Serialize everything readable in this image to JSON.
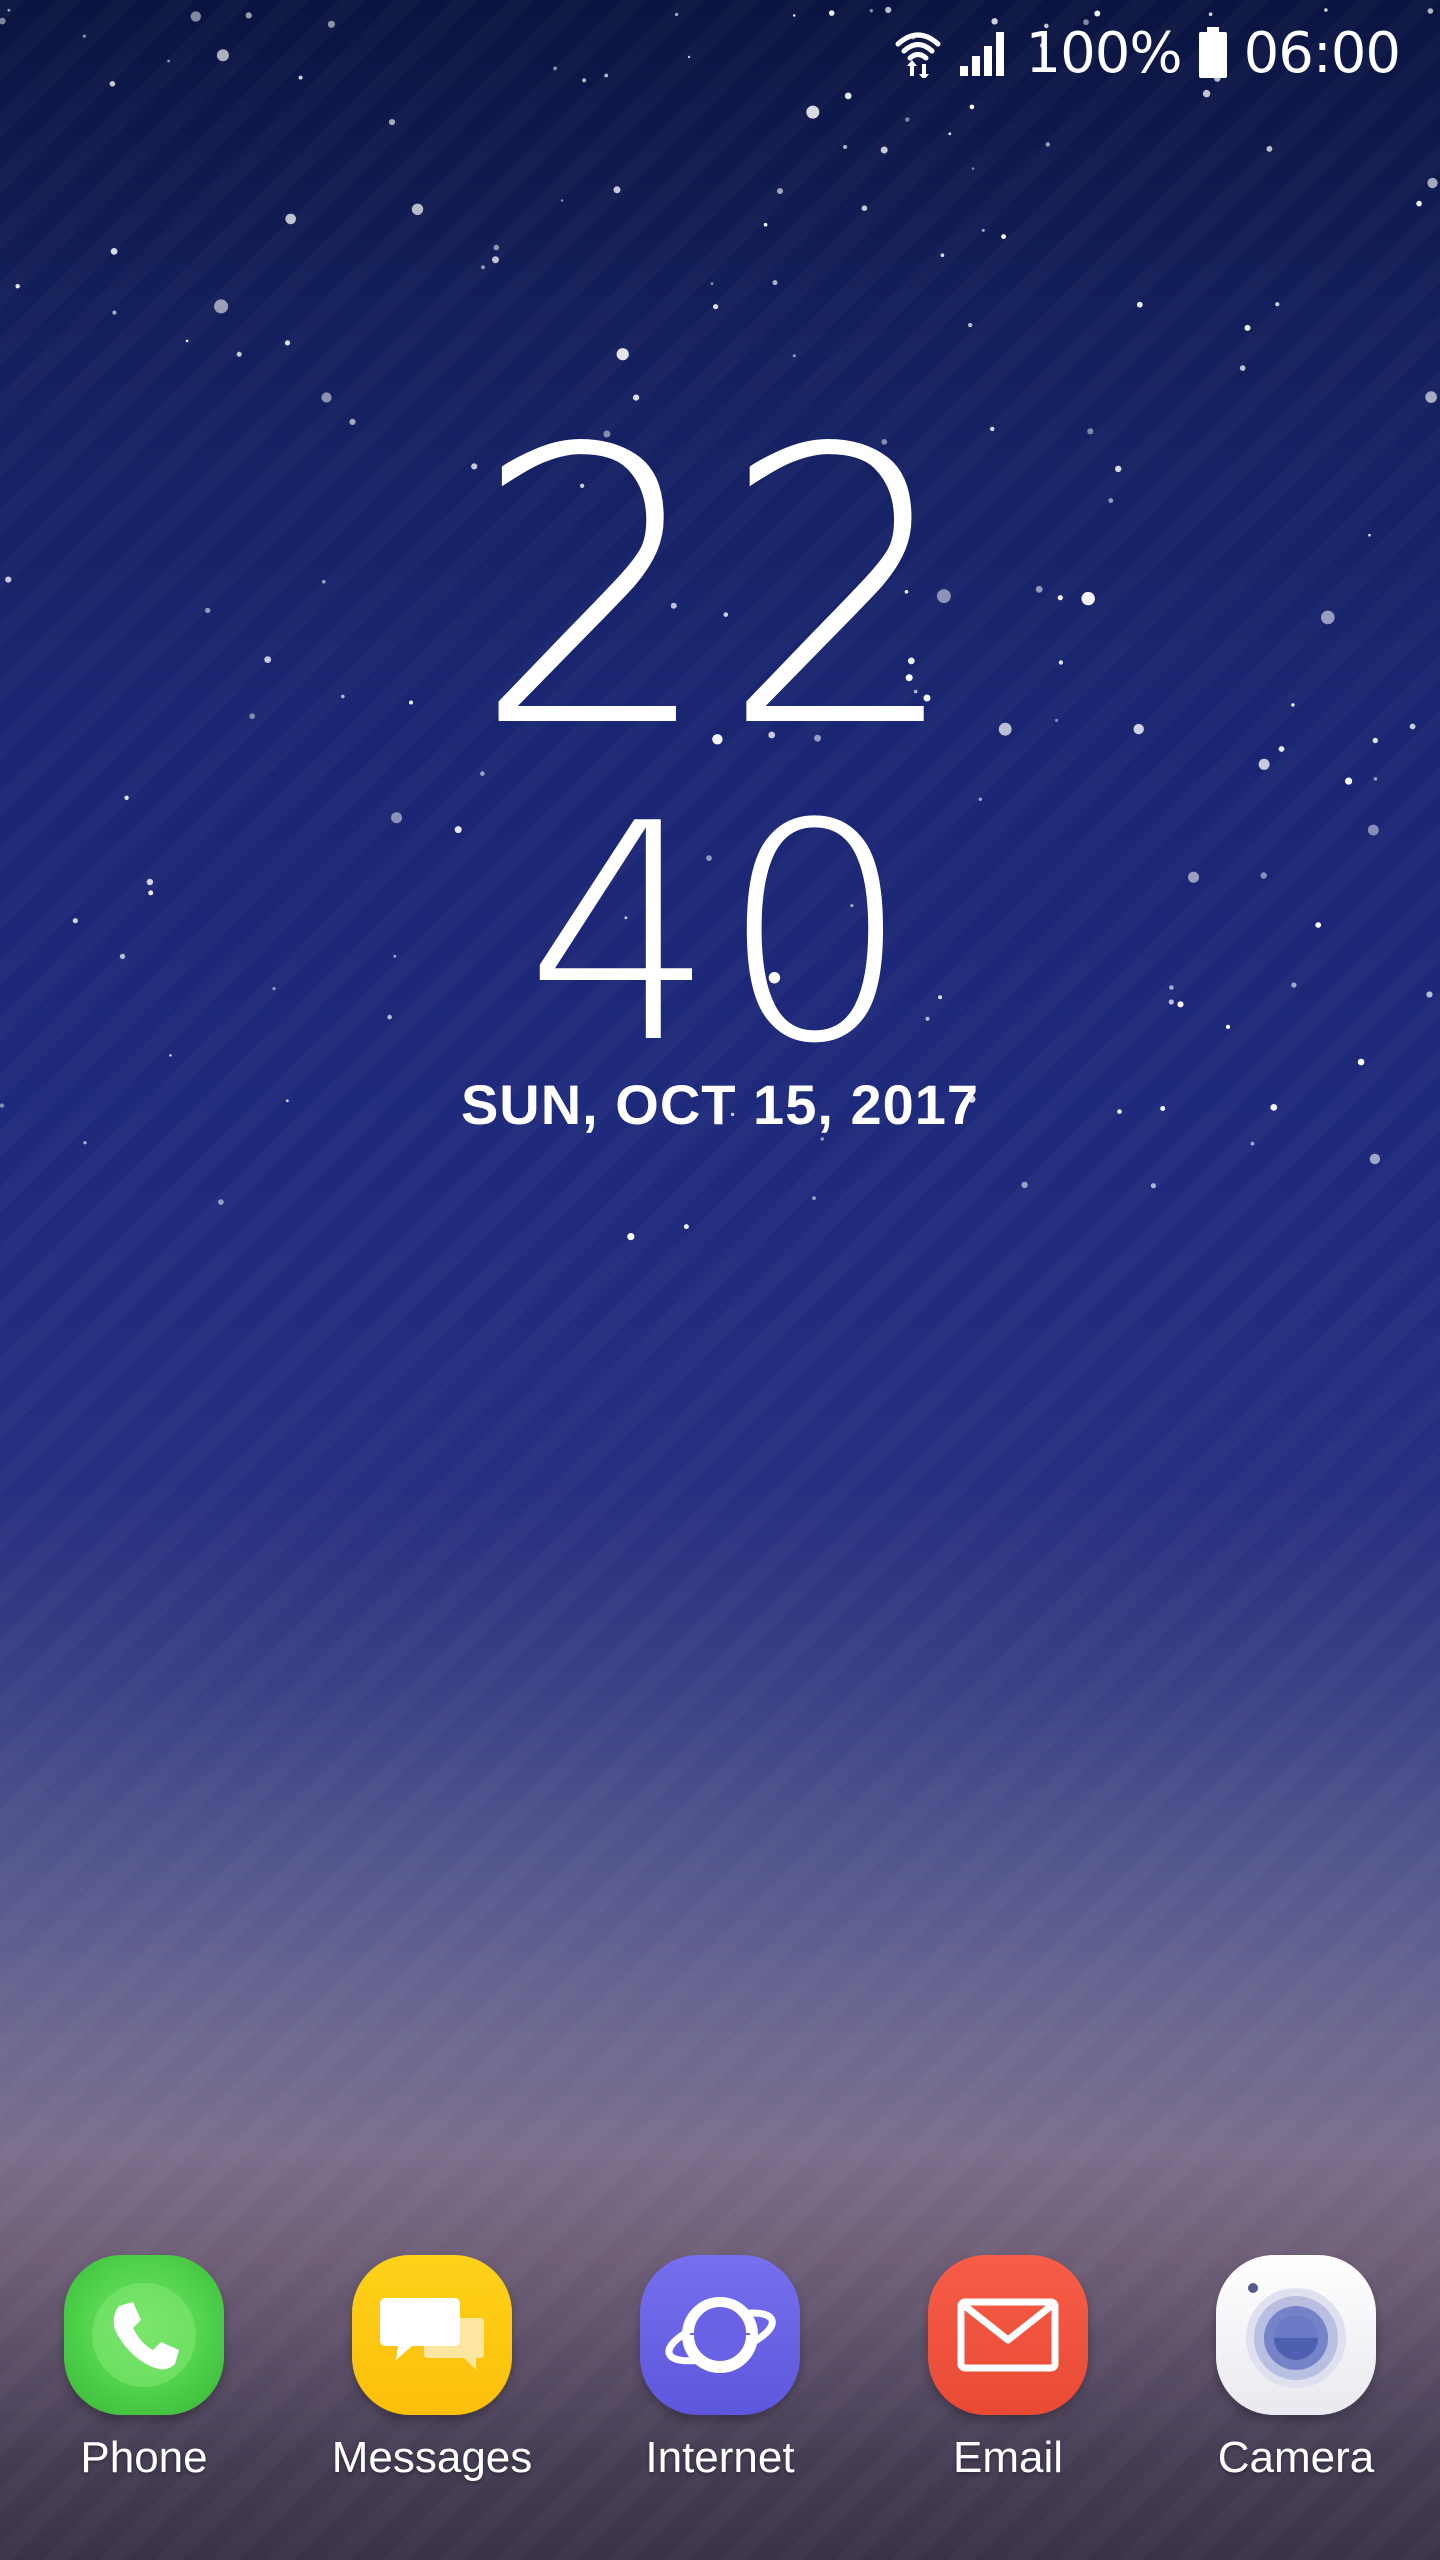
{
  "status_bar": {
    "battery_level": "100%",
    "time": "06:00",
    "icons": [
      "wifi-icon",
      "signal-icon",
      "battery-icon"
    ]
  },
  "clock": {
    "hours": "22",
    "minutes": "40",
    "date": "SUN, OCT 15, 2017"
  },
  "dock": {
    "apps": [
      {
        "label": "Phone",
        "icon": "phone-icon",
        "color": "#4fd14b"
      },
      {
        "label": "Messages",
        "icon": "messages-icon",
        "color": "#ffc814"
      },
      {
        "label": "Internet",
        "icon": "internet-icon",
        "color": "#6c63e6"
      },
      {
        "label": "Email",
        "icon": "email-icon",
        "color": "#f4533c"
      },
      {
        "label": "Camera",
        "icon": "camera-icon",
        "color": "#f2f2f5"
      }
    ]
  }
}
